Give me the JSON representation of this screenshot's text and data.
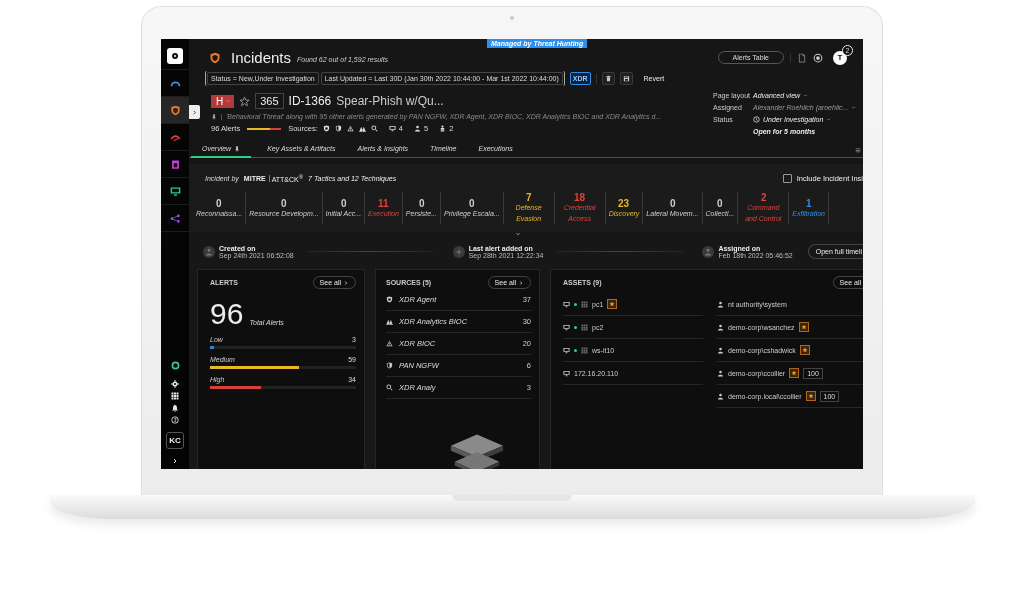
{
  "rail": {
    "top": [
      {
        "kind": "logo",
        "selected": false
      },
      {
        "kind": "gauge",
        "selected": false
      },
      {
        "kind": "shield",
        "selected": true
      },
      {
        "kind": "arc",
        "selected": false
      },
      {
        "kind": "app",
        "selected": false
      },
      {
        "kind": "monitor",
        "selected": false
      },
      {
        "kind": "nodes",
        "selected": false
      }
    ],
    "bottom": [
      {
        "kind": "ring"
      },
      {
        "kind": "gear"
      },
      {
        "kind": "grid"
      },
      {
        "kind": "bell"
      },
      {
        "kind": "help"
      }
    ],
    "user_initials": "KC"
  },
  "header": {
    "title": "Incidents",
    "result_count": "Found 62 out of 1,592 results",
    "banner": "Managed by Threat Hunting",
    "alerts_table_button": "Alerts Table",
    "notification_count": "2",
    "avatar_initial": "T"
  },
  "filters": {
    "chips": [
      "Status = New,Under Investigation",
      "Last Updated = Last 30D (Jan 30th 2022 10:44:00 - Mar 1st 2022 10:44:00)"
    ],
    "xdr_button": "XDR",
    "revert": "Revert"
  },
  "incident": {
    "severity": "H",
    "score": "365",
    "id": "ID-1366",
    "name": "Spear-Phish w/Qu...",
    "description": "'Behavioral Threat' along with 95 other alerts generated by PAN NGFW, XDR Agent, XDR BIOC, XDR Analytics BIOC and XDR Analytics d...",
    "alerts": "96 Alerts",
    "sources_label": "Sources:",
    "source_icons": [
      {
        "kind": "agent"
      },
      {
        "kind": "agent2"
      },
      {
        "kind": "bioc"
      },
      {
        "kind": "analytics_bioc"
      },
      {
        "kind": "analytics"
      }
    ],
    "counts": [
      {
        "kind": "monitor",
        "value": "4"
      },
      {
        "kind": "user",
        "value": "5"
      },
      {
        "kind": "person",
        "value": "2"
      }
    ]
  },
  "details": {
    "rows": [
      {
        "label": "Page layout",
        "value": "Advanced view"
      },
      {
        "label": "Assigned",
        "value": "Alexander Roehlich (aroehlic..."
      },
      {
        "label": "Status",
        "value": "Under Investigation"
      }
    ],
    "open_for": "Open for 5 months"
  },
  "tabs": [
    {
      "label": "Overview",
      "selected": true
    },
    {
      "label": "Key Assets & Artifacts",
      "selected": false
    },
    {
      "label": "Alerts & Insights",
      "selected": false
    },
    {
      "label": "Timeline",
      "selected": false
    },
    {
      "label": "Executions",
      "selected": false
    }
  ],
  "mitre": {
    "prefix": "Incident by",
    "brand": "MITRE",
    "framework": "ATT&CK$^{®}$",
    "summary": "7 Tactics and 12 Techniques",
    "include_checkbox": {
      "label": "Include Incident Insi",
      "checked": false
    },
    "tactics": [
      {
        "count": "0",
        "name": "Reconnaissa...",
        "color": "#cfcfcf"
      },
      {
        "count": "0",
        "name": "Resource Developm...",
        "color": "#cfcfcf"
      },
      {
        "count": "0",
        "name": "Initial Acc...",
        "color": "#cfcfcf"
      },
      {
        "count": "11",
        "name": "Execution",
        "color": "#e0413b"
      },
      {
        "count": "0",
        "name": "Persiste...",
        "color": "#cfcfcf"
      },
      {
        "count": "0",
        "name": "Privilege Escala...",
        "color": "#cfcfcf"
      },
      {
        "count": "7",
        "name": "Defense Evasion",
        "color": "#e8b923"
      },
      {
        "count": "18",
        "name": "Credential Access",
        "color": "#e0413b"
      },
      {
        "count": "23",
        "name": "Discovery",
        "color": "#e8b923"
      },
      {
        "count": "0",
        "name": "Lateral Movem...",
        "color": "#cfcfcf"
      },
      {
        "count": "0",
        "name": "Collecti...",
        "color": "#cfcfcf"
      },
      {
        "count": "2",
        "name": "Command and Control",
        "color": "#e0413b"
      },
      {
        "count": "1",
        "name": "Exfiltration",
        "color": "#2f8fe0"
      }
    ]
  },
  "timeline": {
    "events": [
      {
        "kind": "user",
        "label": "Created on",
        "date": "Sep 24th 2021 06:52:08"
      },
      {
        "kind": "plus",
        "label": "Last alert added on",
        "date": "Sep 28th 2021 12:22:34"
      },
      {
        "kind": "user",
        "label": "Assigned on",
        "date": "Feb 18th 2022 05:46:52"
      }
    ],
    "button": "Open full timeli"
  },
  "alerts_card": {
    "title": "ALERTS",
    "see_all": "See all",
    "total": "96",
    "total_label": "Total Alerts",
    "levels": [
      {
        "label": "Low",
        "count": "3",
        "level": 0.03,
        "color": "#2f7fe0"
      },
      {
        "label": "Medium",
        "count": "59",
        "level": 0.61,
        "color": "#e8b923"
      },
      {
        "label": "High",
        "count": "34",
        "level": 0.35,
        "color": "#d9403a"
      }
    ]
  },
  "sources_card": {
    "title": "SOURCES (5)",
    "see_all": "See all",
    "rows": [
      {
        "kind": "agent",
        "name": "XDR Agent",
        "count": "37"
      },
      {
        "kind": "analytics_bioc",
        "name": "XDR Analytics BIOC",
        "count": "30"
      },
      {
        "kind": "bioc",
        "name": "XDR BIOC",
        "count": "20"
      },
      {
        "kind": "agent2",
        "name": "PAN NGFW",
        "count": "6"
      },
      {
        "kind": "analytics",
        "name": "XDR Analy",
        "count": "3"
      }
    ]
  },
  "assets_card": {
    "title": "ASSETS (9)",
    "see_all": "See all",
    "hosts": [
      {
        "name": "pc1",
        "online": true,
        "starred": true
      },
      {
        "name": "pc2",
        "online": true,
        "starred": false
      },
      {
        "name": "ws-it10",
        "online": true,
        "starred": false
      },
      {
        "name": "172.16.20.110",
        "online": false,
        "starred": false
      }
    ],
    "users": [
      {
        "name": "nt authority\\system",
        "starred": false
      },
      {
        "name": "demo-corp\\wsanchez",
        "starred": true
      },
      {
        "name": "demo-corp\\cshadwick",
        "starred": true
      },
      {
        "name": "demo-corp\\ccollier",
        "starred": true,
        "score": "100"
      },
      {
        "name": "demo-corp.local\\ccollier",
        "starred": true,
        "score": "100"
      }
    ]
  }
}
